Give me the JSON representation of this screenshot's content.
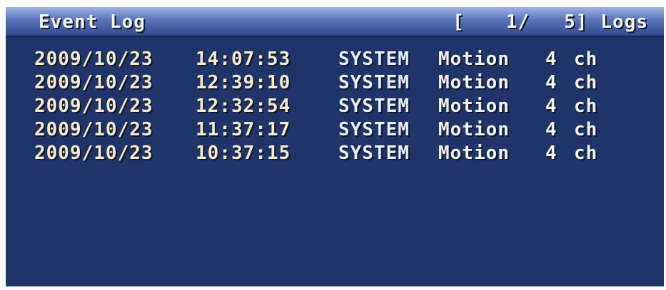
{
  "header": {
    "title": "Event Log",
    "counter": {
      "open": "[",
      "current": "1",
      "slash": "/",
      "total": "5",
      "close": "]",
      "unit": "Logs"
    }
  },
  "logs": [
    {
      "date": "2009/10/23",
      "time": "14:07:53",
      "source": "SYSTEM",
      "event": "Motion",
      "channel": "4",
      "ch": "ch"
    },
    {
      "date": "2009/10/23",
      "time": "12:39:10",
      "source": "SYSTEM",
      "event": "Motion",
      "channel": "4",
      "ch": "ch"
    },
    {
      "date": "2009/10/23",
      "time": "12:32:54",
      "source": "SYSTEM",
      "event": "Motion",
      "channel": "4",
      "ch": "ch"
    },
    {
      "date": "2009/10/23",
      "time": "11:37:17",
      "source": "SYSTEM",
      "event": "Motion",
      "channel": "4",
      "ch": "ch"
    },
    {
      "date": "2009/10/23",
      "time": "10:37:15",
      "source": "SYSTEM",
      "event": "Motion",
      "channel": "4",
      "ch": "ch"
    }
  ]
}
